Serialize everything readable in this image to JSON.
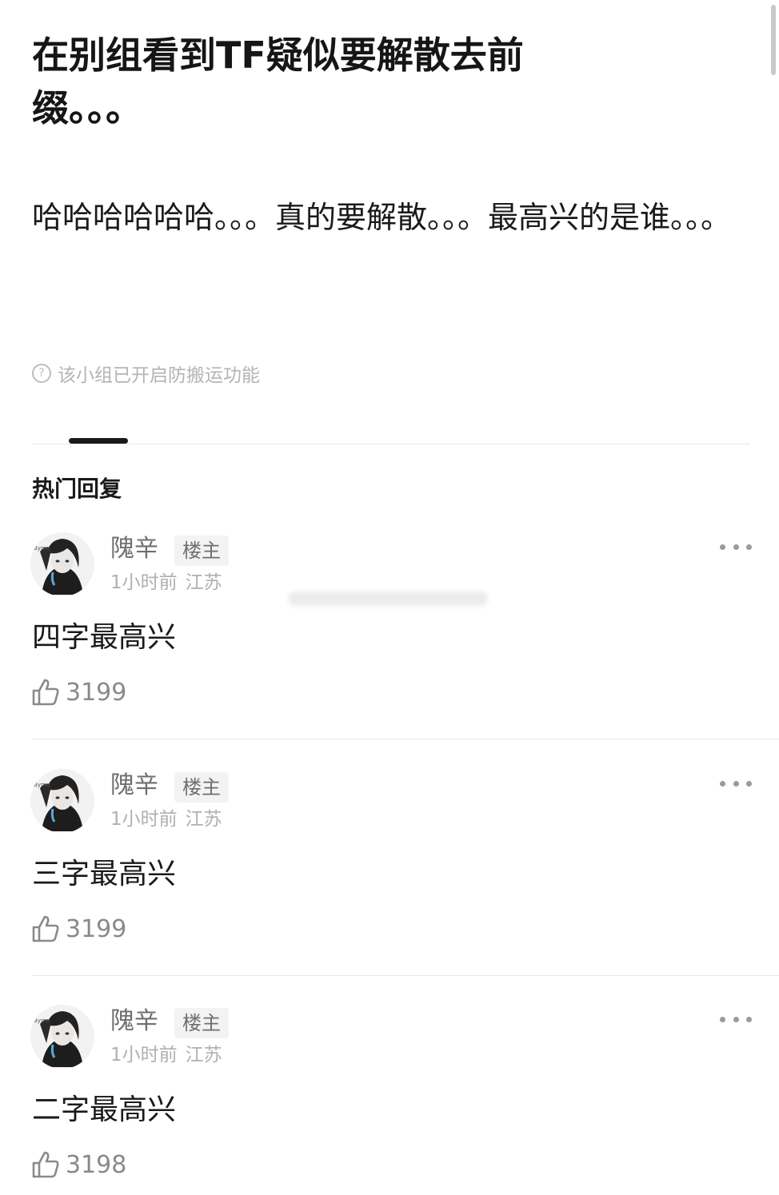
{
  "post": {
    "title": "在别组看到TF疑似要解散去前缀。。。",
    "body": "哈哈哈哈哈哈。。。真的要解散。。。最高兴的是谁。。。",
    "notice": "该小组已开启防搬运功能",
    "notice_icon": "question-circle-icon"
  },
  "replies_section": {
    "title": "热门回复"
  },
  "replies": [
    {
      "author": "隗辛",
      "badge": "楼主",
      "time": "1小时前",
      "location": "江苏",
      "text": "四字最高兴",
      "likes": "3199"
    },
    {
      "author": "隗辛",
      "badge": "楼主",
      "time": "1小时前",
      "location": "江苏",
      "text": "三字最高兴",
      "likes": "3199"
    },
    {
      "author": "隗辛",
      "badge": "楼主",
      "time": "1小时前",
      "location": "江苏",
      "text": "二字最高兴",
      "likes": "3198"
    }
  ],
  "colors": {
    "text_primary": "#1a1a1a",
    "text_secondary": "#6f6f6f",
    "text_muted": "#b0b0b0",
    "badge_bg": "#f3f3f3",
    "divider": "#e6e6e6"
  }
}
